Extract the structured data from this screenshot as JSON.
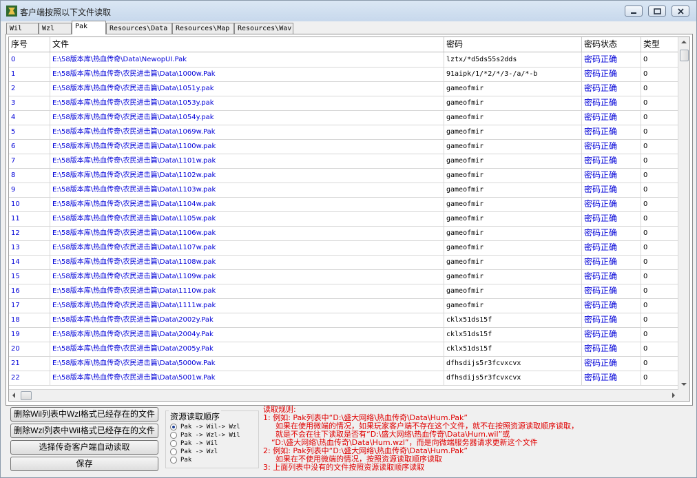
{
  "window": {
    "title": "客户端按照以下文件读取"
  },
  "tabs": [
    {
      "label": "Wil",
      "active": false
    },
    {
      "label": "Wzl",
      "active": false
    },
    {
      "label": "Pak",
      "active": true
    },
    {
      "label": "Resources\\Data",
      "active": false
    },
    {
      "label": "Resources\\Map",
      "active": false
    },
    {
      "label": "Resources\\Wav",
      "active": false
    }
  ],
  "table": {
    "columns": [
      "序号",
      "文件",
      "密码",
      "密码状态",
      "类型"
    ],
    "rows": [
      [
        "0",
        "E:\\58版本库\\热血传奇\\Data\\NewopUI.Pak",
        "lztx/*d5ds55s2dds",
        "密码正确",
        "0"
      ],
      [
        "1",
        "E:\\58版本库\\热血传奇\\农民进击篇\\Data\\1000w.Pak",
        "91aipk/1/*2/*/3-/a/*-b",
        "密码正确",
        "0"
      ],
      [
        "2",
        "E:\\58版本库\\热血传奇\\农民进击篇\\Data\\1051y.pak",
        "gameofmir",
        "密码正确",
        "0"
      ],
      [
        "3",
        "E:\\58版本库\\热血传奇\\农民进击篇\\Data\\1053y.pak",
        "gameofmir",
        "密码正确",
        "0"
      ],
      [
        "4",
        "E:\\58版本库\\热血传奇\\农民进击篇\\Data\\1054y.pak",
        "gameofmir",
        "密码正确",
        "0"
      ],
      [
        "5",
        "E:\\58版本库\\热血传奇\\农民进击篇\\Data\\1069w.Pak",
        "gameofmir",
        "密码正确",
        "0"
      ],
      [
        "6",
        "E:\\58版本库\\热血传奇\\农民进击篇\\Data\\1100w.pak",
        "gameofmir",
        "密码正确",
        "0"
      ],
      [
        "7",
        "E:\\58版本库\\热血传奇\\农民进击篇\\Data\\1101w.pak",
        "gameofmir",
        "密码正确",
        "0"
      ],
      [
        "8",
        "E:\\58版本库\\热血传奇\\农民进击篇\\Data\\1102w.pak",
        "gameofmir",
        "密码正确",
        "0"
      ],
      [
        "9",
        "E:\\58版本库\\热血传奇\\农民进击篇\\Data\\1103w.pak",
        "gameofmir",
        "密码正确",
        "0"
      ],
      [
        "10",
        "E:\\58版本库\\热血传奇\\农民进击篇\\Data\\1104w.pak",
        "gameofmir",
        "密码正确",
        "0"
      ],
      [
        "11",
        "E:\\58版本库\\热血传奇\\农民进击篇\\Data\\1105w.pak",
        "gameofmir",
        "密码正确",
        "0"
      ],
      [
        "12",
        "E:\\58版本库\\热血传奇\\农民进击篇\\Data\\1106w.pak",
        "gameofmir",
        "密码正确",
        "0"
      ],
      [
        "13",
        "E:\\58版本库\\热血传奇\\农民进击篇\\Data\\1107w.pak",
        "gameofmir",
        "密码正确",
        "0"
      ],
      [
        "14",
        "E:\\58版本库\\热血传奇\\农民进击篇\\Data\\1108w.pak",
        "gameofmir",
        "密码正确",
        "0"
      ],
      [
        "15",
        "E:\\58版本库\\热血传奇\\农民进击篇\\Data\\1109w.pak",
        "gameofmir",
        "密码正确",
        "0"
      ],
      [
        "16",
        "E:\\58版本库\\热血传奇\\农民进击篇\\Data\\1110w.pak",
        "gameofmir",
        "密码正确",
        "0"
      ],
      [
        "17",
        "E:\\58版本库\\热血传奇\\农民进击篇\\Data\\1111w.pak",
        "gameofmir",
        "密码正确",
        "0"
      ],
      [
        "18",
        "E:\\58版本库\\热血传奇\\农民进击篇\\Data\\2002y.Pak",
        "cklx51ds15f",
        "密码正确",
        "0"
      ],
      [
        "19",
        "E:\\58版本库\\热血传奇\\农民进击篇\\Data\\2004y.Pak",
        "cklx51ds15f",
        "密码正确",
        "0"
      ],
      [
        "20",
        "E:\\58版本库\\热血传奇\\农民进击篇\\Data\\2005y.Pak",
        "cklx51ds15f",
        "密码正确",
        "0"
      ],
      [
        "21",
        "E:\\58版本库\\热血传奇\\农民进击篇\\Data\\5000w.Pak",
        "dfhsdijs5r3fcvxcvx",
        "密码正确",
        "0"
      ],
      [
        "22",
        "E:\\58版本库\\热血传奇\\农民进击篇\\Data\\5001w.Pak",
        "dfhsdijs5r3fcvxcvx",
        "密码正确",
        "0"
      ]
    ]
  },
  "buttons": {
    "delete_wil": "删除Wil列表中Wzl格式已经存在的文件",
    "delete_wzl": "删除Wzl列表中Wil格式已经存在的文件",
    "auto_read": "选择传奇客户端自动读取",
    "save": "保存"
  },
  "resource_order": {
    "title": "资源读取顺序",
    "options": [
      {
        "label": "Pak -> Wil-> Wzl",
        "selected": true
      },
      {
        "label": "Pak -> Wzl-> Wil",
        "selected": false
      },
      {
        "label": "Pak -> Wil",
        "selected": false
      },
      {
        "label": "Pak -> Wzl",
        "selected": false
      },
      {
        "label": "Pak",
        "selected": false
      }
    ]
  },
  "rules": {
    "lines": [
      "读取规则:",
      "1: 例如: Pak列表中“D:\\盛大网络\\热血传奇\\Data\\Hum.Pak”",
      "如果在使用微端的情况，如果玩家客户端不存在这个文件，就不在按照资源读取顺序读取，",
      "就是不会在往下读取是否有“D:\\盛大网络\\热血传奇\\Data\\Hum.wil”或",
      "“D:\\盛大网络\\热血传奇\\Data\\Hum.wzl”，而是向微端服务器请求更新这个文件",
      "2: 例如: Pak列表中“D:\\盛大网络\\热血传奇\\Data\\Hum.Pak”",
      "如果在不使用微端的情况，按照资源读取顺序读取",
      "3: 上面列表中没有的文件按照资源读取顺序读取"
    ]
  }
}
